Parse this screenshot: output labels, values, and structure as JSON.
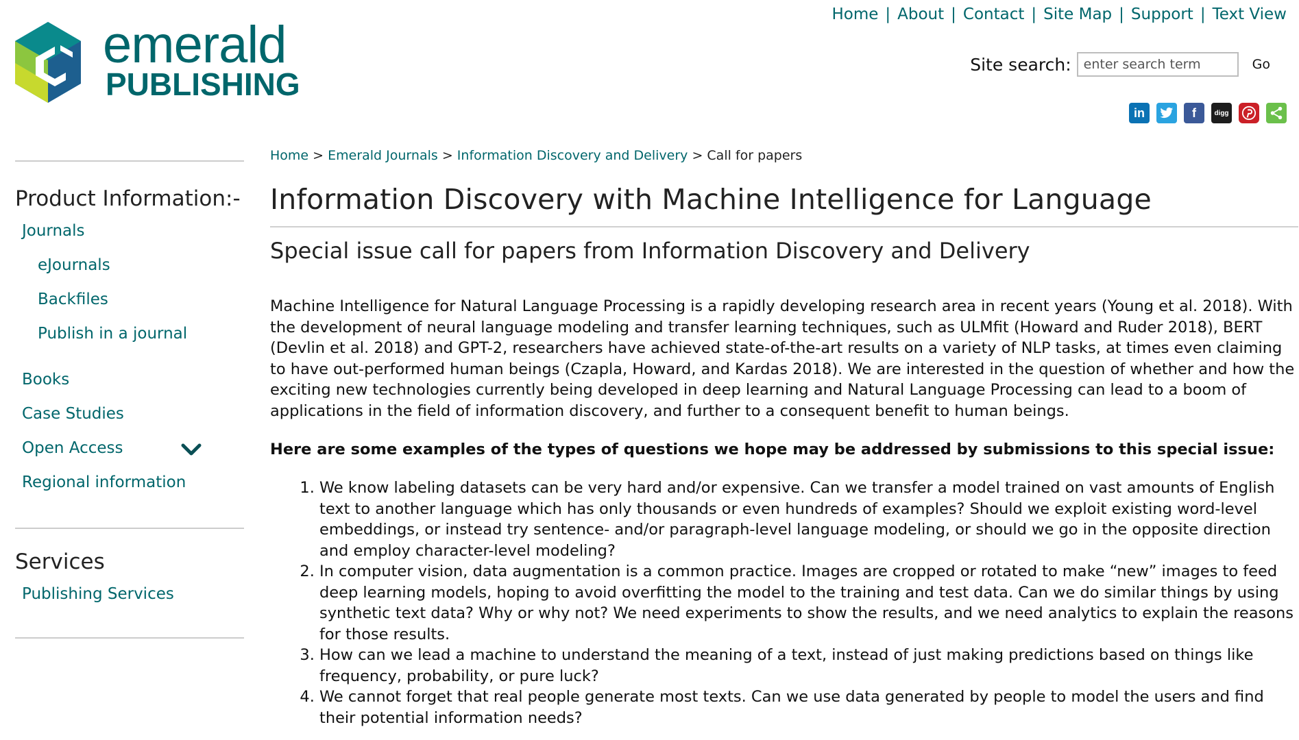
{
  "logo": {
    "word1": "emerald",
    "word2": "PUBLISHING",
    "colors": {
      "teal": "#00666b",
      "green": "#8cc63f",
      "lime": "#c7d92e",
      "blue": "#1b7fae",
      "dark_teal": "#0a5963"
    }
  },
  "topnav": {
    "items": [
      "Home",
      "About",
      "Contact",
      "Site Map",
      "Support",
      "Text View"
    ],
    "separator": "|"
  },
  "search": {
    "label": "Site search:",
    "placeholder": "enter search term",
    "button": "Go"
  },
  "share": {
    "icons": [
      {
        "name": "linkedin-icon",
        "glyph": "in",
        "color": "#0b72b4"
      },
      {
        "name": "twitter-icon",
        "glyph": "t",
        "color": "#2aa3e0"
      },
      {
        "name": "facebook-icon",
        "glyph": "f",
        "color": "#3b5998"
      },
      {
        "name": "digg-icon",
        "glyph": "digg",
        "color": "#1d1d1d"
      },
      {
        "name": "pinterest-icon",
        "glyph": "P",
        "color": "#cb2027"
      },
      {
        "name": "share-icon",
        "glyph": "<",
        "color": "#6bc04b"
      }
    ]
  },
  "sidebar": {
    "product_heading": "Product Information:-",
    "product_items": [
      {
        "label": "Journals",
        "level": 1
      },
      {
        "label": "eJournals",
        "level": 2
      },
      {
        "label": "Backfiles",
        "level": 2
      },
      {
        "label": "Publish in a journal",
        "level": 2
      },
      {
        "label": "Books",
        "level": 1
      },
      {
        "label": "Case Studies",
        "level": 1
      },
      {
        "label": "Open Access",
        "level": 1,
        "expandable": true
      },
      {
        "label": "Regional information",
        "level": 1
      }
    ],
    "services_heading": "Services",
    "services_items": [
      {
        "label": "Publishing Services"
      }
    ]
  },
  "breadcrumb": {
    "items": [
      "Home",
      "Emerald Journals",
      "Information Discovery and Delivery"
    ],
    "current": "Call for papers",
    "separator": ">"
  },
  "main": {
    "title": "Information Discovery with Machine Intelligence for Language",
    "subtitle": "Special issue call for papers from Information Discovery and Delivery",
    "intro": "Machine Intelligence for Natural Language Processing is a rapidly developing research area in recent years (Young et al. 2018). With the development of neural language modeling and transfer learning techniques, such as ULMfit (Howard and Ruder 2018), BERT (Devlin et al. 2018) and GPT-2, researchers have achieved state-of-the-art results on a variety of NLP tasks, at times even claiming to have out-performed human beings (Czapla, Howard, and Kardas 2018). We are interested in the question of whether and how the exciting new technologies currently being developed in deep learning and Natural Language Processing can lead to a boom of applications in the field of information discovery, and further to a consequent benefit to human beings.",
    "questions_heading": "Here are some examples of the types of questions we hope may be addressed by submissions to this special issue:",
    "questions": [
      "We know labeling datasets can be very hard and/or expensive. Can we transfer a model trained on vast amounts of English text to another language which has only thousands or even hundreds of examples? Should we exploit existing word-level embeddings, or instead try sentence- and/or paragraph-level language modeling, or should we go in the opposite direction and employ character-level modeling?",
      "In computer vision, data augmentation is a common practice. Images are cropped or rotated to make “new” images to feed deep learning models, hoping to avoid overfitting the model to the training and test data. Can we do similar things by using synthetic text data? Why or why not? We need experiments to show the results, and we need analytics to explain the reasons for those results.",
      "How can we lead a machine to understand the meaning of a text, instead of just making predictions based on things like frequency, probability, or pure luck?",
      "We cannot forget that real people generate most texts. Can we use data generated by people to model the users and find their potential information needs?"
    ]
  }
}
